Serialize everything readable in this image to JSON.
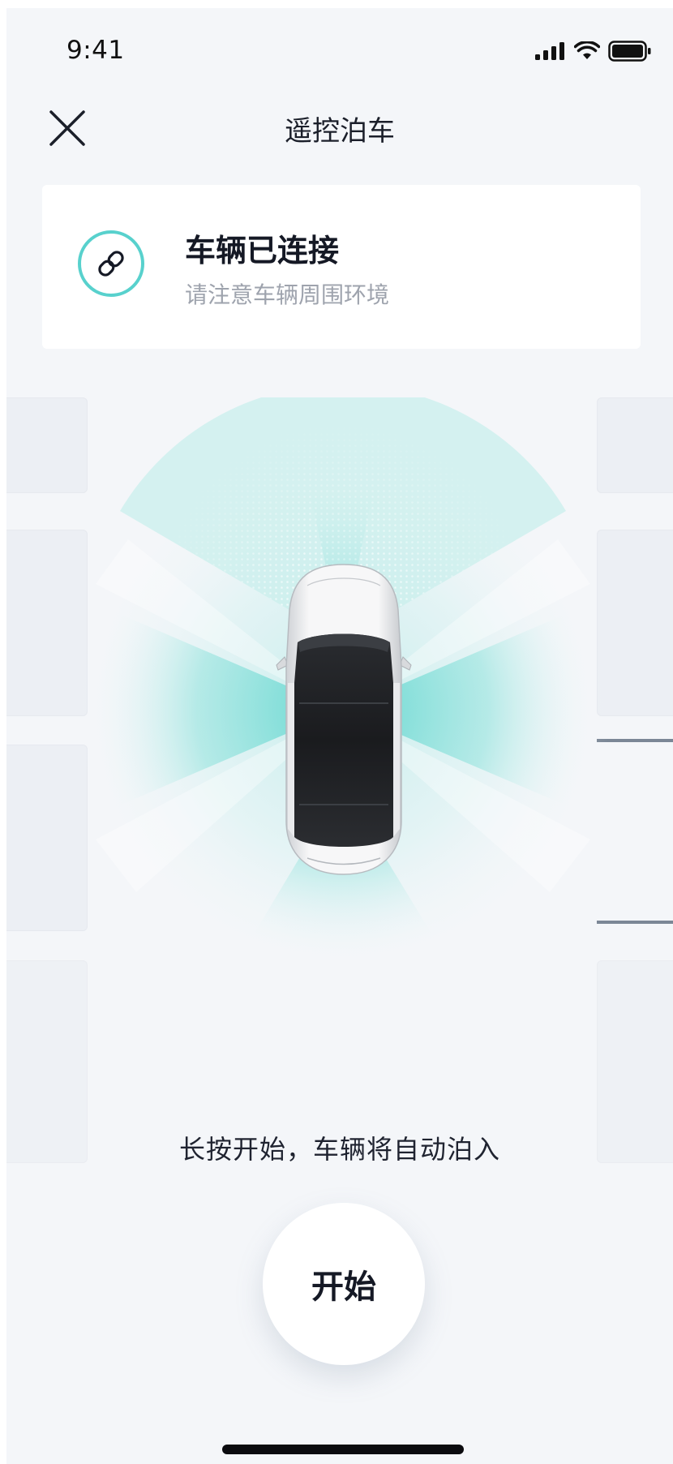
{
  "status_bar": {
    "time": "9:41"
  },
  "nav": {
    "title": "遥控泊车",
    "close_icon": "close-icon"
  },
  "connection": {
    "title": "车辆已连接",
    "subtitle": "请注意车辆周围环境",
    "icon": "link-icon",
    "accent_color": "#58d1cd"
  },
  "scene": {
    "sensor_color": "#5fd6cf"
  },
  "hint": "长按开始，车辆将自动泊入",
  "start_button": {
    "label": "开始"
  }
}
